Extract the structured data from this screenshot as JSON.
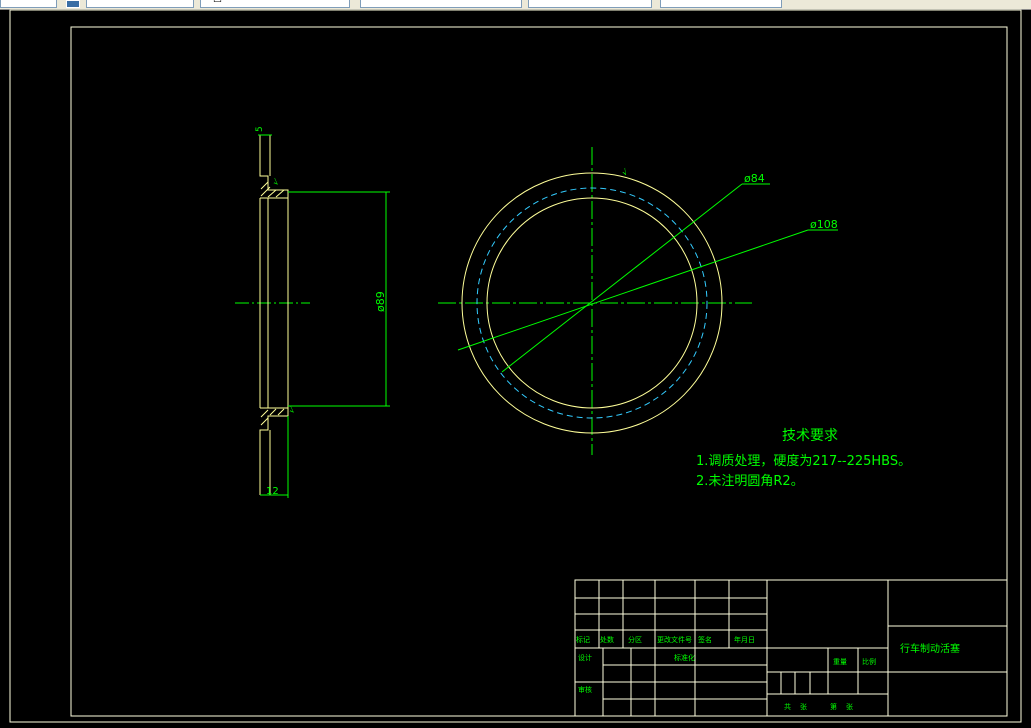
{
  "toolbar": {
    "fields": [
      {
        "name": "layer-combo"
      },
      {
        "name": "color-combo"
      },
      {
        "name": "linetype-combo"
      },
      {
        "name": "lineweight-combo"
      },
      {
        "name": "plotstyle-combo"
      }
    ]
  },
  "colors": {
    "background": "#000000",
    "frame": "#ffffe0",
    "part_lines": "#ffff99",
    "dimensions": "#00ff00",
    "center_lines": "#00ff00",
    "hidden_circle": "#33ccff",
    "text": "#00ff00"
  },
  "drawing": {
    "dimensions": {
      "top_gap": "5",
      "outer_diameter": "ø89",
      "bottom_width": "12",
      "circle_84": "ø84",
      "circle_108": "ø108"
    },
    "roughness": [
      "√",
      "√",
      "√"
    ],
    "tech_requirements": {
      "title": "技术要求",
      "line1": "1.调质处理，硬度为217--225HBS。",
      "line2": "2.未注明圆角R2。"
    },
    "title_block": {
      "part_name": "行车制动活塞",
      "cells": {
        "mark": "标记",
        "count": "处数",
        "zone": "分区",
        "change_doc": "更改文件号",
        "sign": "签名",
        "date": "年月日",
        "design": "设计",
        "standardize": "标准化",
        "review": "审核",
        "stage_mark": "阶段标记",
        "weight": "重量",
        "scale": "比例",
        "total": "共",
        "sheet": "张",
        "page_di": "第",
        "page_zhang": "张"
      }
    }
  }
}
